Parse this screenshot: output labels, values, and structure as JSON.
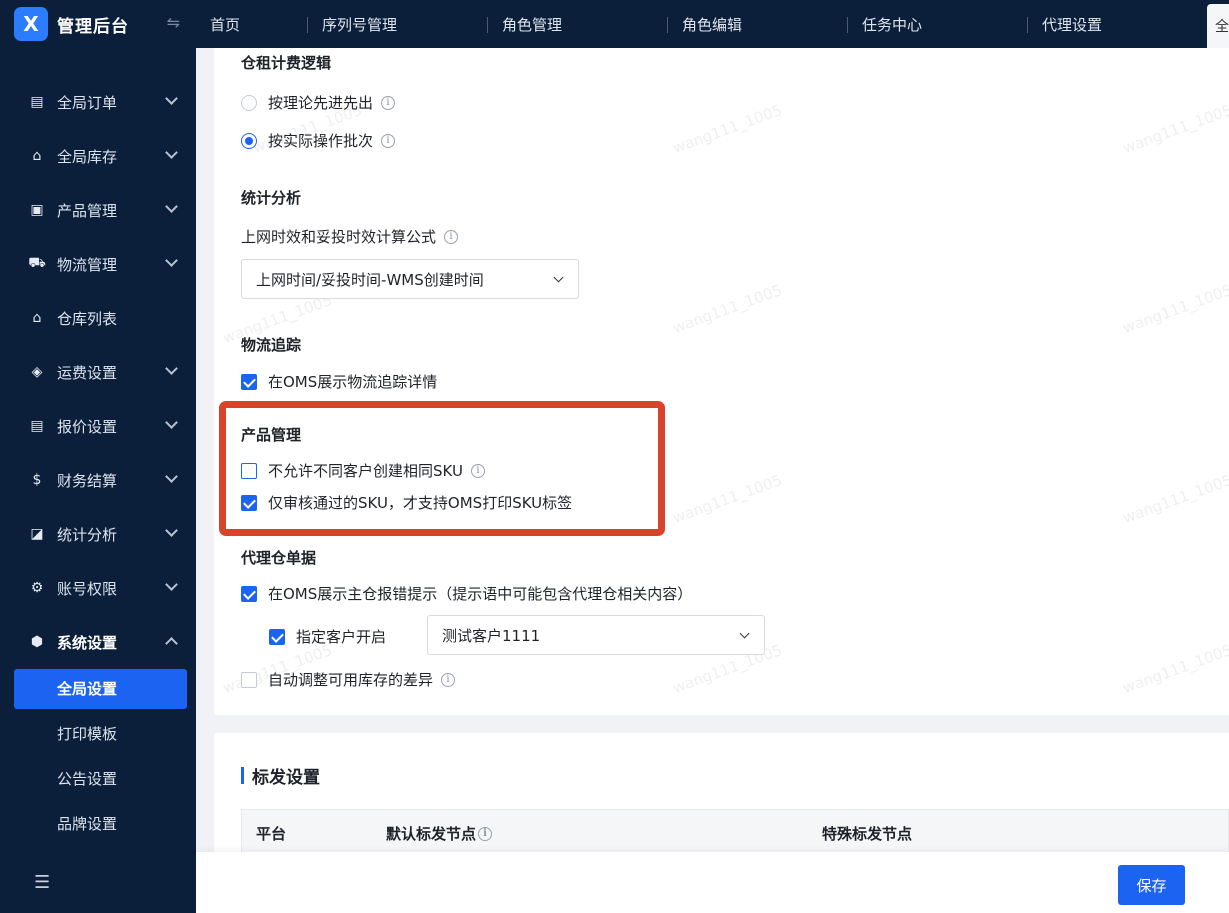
{
  "brand": {
    "logo": "X",
    "title": "管理后台",
    "toggle_icon": "⇋"
  },
  "menu": [
    {
      "label": "全局订单",
      "icon": "clipboard-icon",
      "glyph": "▤"
    },
    {
      "label": "全局库存",
      "icon": "warehouse-icon",
      "glyph": "⌂"
    },
    {
      "label": "产品管理",
      "icon": "product-box-icon",
      "glyph": "▣"
    },
    {
      "label": "物流管理",
      "icon": "truck-icon",
      "glyph": "⛟"
    },
    {
      "label": "仓库列表",
      "icon": "warehouse-list-icon",
      "glyph": "⌂"
    },
    {
      "label": "运费设置",
      "icon": "freight-icon",
      "glyph": "◈"
    },
    {
      "label": "报价设置",
      "icon": "quote-icon",
      "glyph": "▤"
    },
    {
      "label": "财务结算",
      "icon": "finance-icon",
      "glyph": "$"
    },
    {
      "label": "统计分析",
      "icon": "chart-icon",
      "glyph": "◪"
    },
    {
      "label": "账号权限",
      "icon": "org-icon",
      "glyph": "⚙"
    },
    {
      "label": "系统设置",
      "icon": "settings-icon",
      "glyph": "⬢"
    }
  ],
  "submenu": [
    {
      "label": "全局设置"
    },
    {
      "label": "打印模板"
    },
    {
      "label": "公告设置"
    },
    {
      "label": "品牌设置"
    }
  ],
  "tabs": [
    "首页",
    "序列号管理",
    "角色管理",
    "角色编辑",
    "任务中心",
    "代理设置"
  ],
  "tab_new": "全",
  "rent": {
    "title": "仓租计费逻辑",
    "opt1": "按理论先进先出",
    "opt2": "按实际操作批次"
  },
  "stats": {
    "title": "统计分析",
    "label": "上网时效和妥投时效计算公式",
    "select": "上网时间/妥投时间-WMS创建时间"
  },
  "tracking": {
    "title": "物流追踪",
    "opt1": "在OMS展示物流追踪详情"
  },
  "product": {
    "title": "产品管理",
    "opt1": "不允许不同客户创建相同SKU",
    "opt2": "仅审核通过的SKU，才支持OMS打印SKU标签"
  },
  "agent": {
    "title": "代理仓单据",
    "opt1": "在OMS展示主仓报错提示（提示语中可能包含代理仓相关内容）",
    "opt2": "指定客户开启",
    "select": "测试客户1111",
    "opt3": "自动调整可用库存的差异"
  },
  "label_settings": {
    "title": "标发设置",
    "col1": "平台",
    "col2": "默认标发节点",
    "col3": "特殊标发节点"
  },
  "save_label": "保存",
  "bottom_icon": "☰",
  "watermark": "wang111_1005",
  "colors": {
    "sidebar": "#0b1f3a",
    "accent": "#1c63f2",
    "highlight": "#d9432a"
  }
}
